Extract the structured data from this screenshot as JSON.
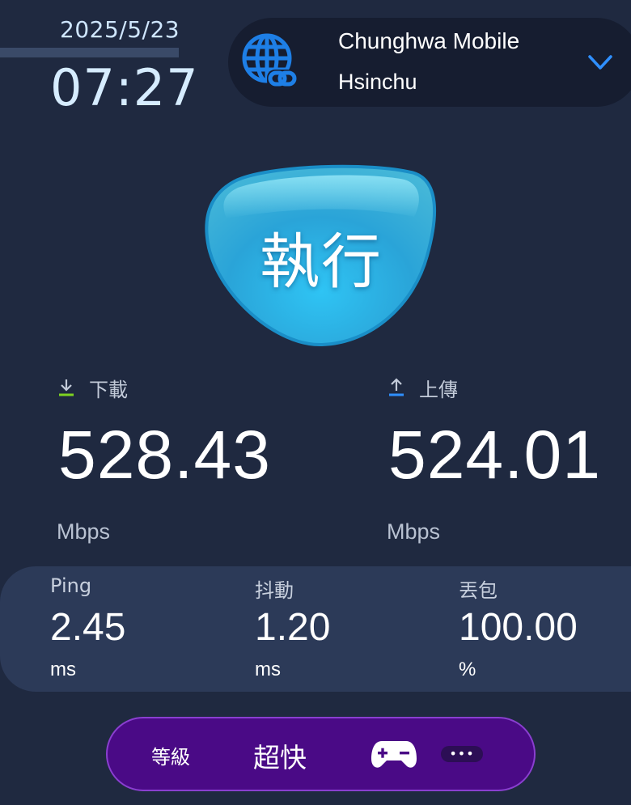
{
  "header": {
    "date": "2025/5/23",
    "time": "07:27"
  },
  "server": {
    "isp": "Chunghwa Mobile",
    "city": "Hsinchu",
    "icon": "globe-link-icon",
    "dropdown_icon": "chevron-down-icon"
  },
  "go_button": {
    "label": "執行"
  },
  "download": {
    "label": "下載",
    "value": "528.43",
    "unit": "Mbps",
    "icon": "download-arrow-icon",
    "icon_color": "#7ed321"
  },
  "upload": {
    "label": "上傳",
    "value": "524.01",
    "unit": "Mbps",
    "icon": "upload-arrow-icon",
    "icon_color": "#2f8fff"
  },
  "stats": {
    "ping": {
      "label": "Ping",
      "value": "2.45",
      "unit": "ms"
    },
    "jitter": {
      "label": "抖動",
      "value": "1.20",
      "unit": "ms"
    },
    "loss": {
      "label": "丟包",
      "value": "100.00",
      "unit": "%"
    }
  },
  "grade": {
    "label": "等級",
    "value": "超快",
    "icon": "gamepad-icon",
    "more_label": "•••"
  },
  "colors": {
    "background": "#1f2940",
    "accent_blue": "#2aa8e0",
    "grade_purple": "#4a0a86"
  }
}
